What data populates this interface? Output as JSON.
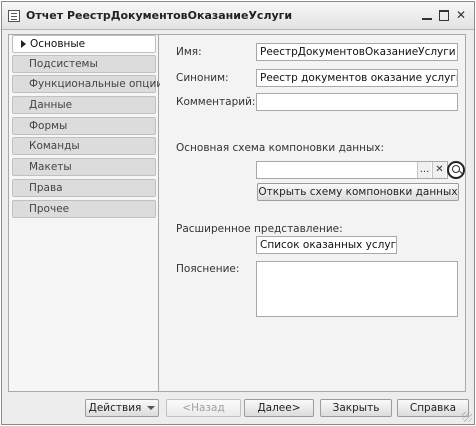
{
  "window": {
    "title": "Отчет РеестрДокументовОказаниеУслуги",
    "minimize_icon": "minimize-icon",
    "maximize_icon": "maximize-icon",
    "close_glyph": "✕"
  },
  "sidebar": {
    "items": [
      {
        "label": "Основные",
        "active": true
      },
      {
        "label": "Подсистемы"
      },
      {
        "label": "Функциональные опции"
      },
      {
        "label": "Данные"
      },
      {
        "label": "Формы"
      },
      {
        "label": "Команды"
      },
      {
        "label": "Макеты"
      },
      {
        "label": "Права"
      },
      {
        "label": "Прочее"
      }
    ]
  },
  "form": {
    "name_label": "Имя:",
    "name_value": "РеестрДокументовОказаниеУслуги",
    "synonym_label": "Синоним:",
    "synonym_value": "Реестр документов оказание услуги",
    "comment_label": "Комментарий:",
    "comment_value": "",
    "schema_label": "Основная схема компоновки данных:",
    "schema_value": "",
    "schema_select_glyph": "...",
    "schema_clear_glyph": "✕",
    "open_schema_button": "Открыть схему компоновки данных",
    "extended_label": "Расширенное представление:",
    "extended_value": "Список оказанных услуг",
    "explanation_label": "Пояснение:",
    "explanation_value": ""
  },
  "buttons": {
    "actions": "Действия",
    "back": "<Назад",
    "next": "Далее>",
    "close": "Закрыть",
    "help": "Справка"
  }
}
